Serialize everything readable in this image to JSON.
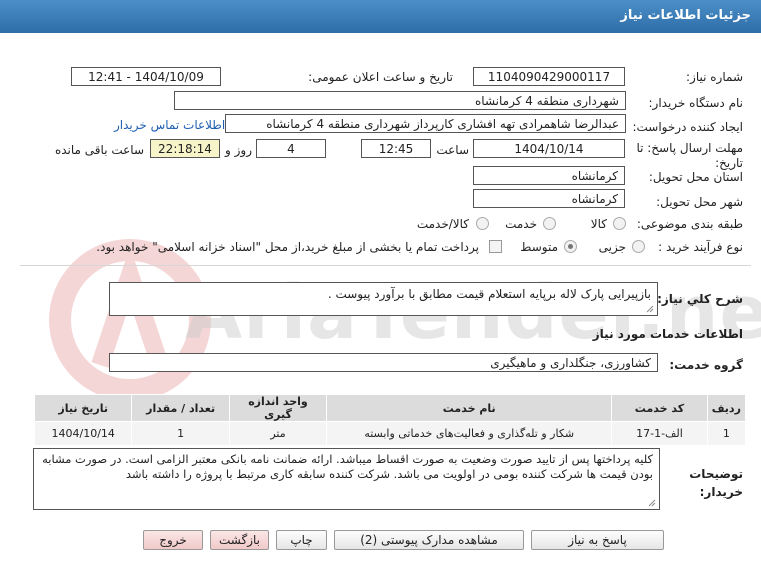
{
  "header": {
    "title": "جزئیات اطلاعات نیاز"
  },
  "fields": {
    "need_number_label": "شماره نیاز:",
    "need_number": "1104090429000117",
    "announce_label": "تاریخ و ساعت اعلان عمومی:",
    "announce_value": "1404/10/09 - 12:41",
    "buyer_org_label": "نام دستگاه خریدار:",
    "buyer_org": "شهرداری منطقه 4 کرمانشاه",
    "creator_label": "ایجاد کننده درخواست:",
    "creator": "عبدالرضا شاهمرادی تهه افشاری کارپرداز شهرداری منطقه 4 کرمانشاه",
    "contact_link": "اطلاعات تماس خریدار",
    "deadline_label": "مهلت ارسال پاسخ: تا تاریخ:",
    "deadline_date": "1404/10/14",
    "time_label": "ساعت",
    "deadline_time": "12:45",
    "days_value": "4",
    "days_label": "روز و",
    "remaining_time": "22:18:14",
    "remaining_label": "ساعت باقی مانده",
    "province_label": "استان محل تحویل:",
    "province": "کرمانشاه",
    "city_label": "شهر محل تحویل:",
    "city": "کرمانشاه",
    "category_label": "طبقه بندی موضوعی:",
    "category_options": [
      "کالا",
      "خدمت",
      "کالا/خدمت"
    ],
    "purchase_label": "نوع فرآیند خرید :",
    "purchase_options": [
      "جزیی",
      "متوسط"
    ],
    "treasury_text": "پرداخت تمام یا بخشی از مبلغ خرید،از محل \"اسناد خزانه اسلامی\" خواهد بود."
  },
  "description": {
    "label": "شرح کلي نياز:",
    "text": "بازپیرایی پارک لاله  برپایه استعلام قیمت مطابق با برآورد پیوست ."
  },
  "services": {
    "section_title": "اطلاعات خدمات مورد نياز",
    "group_label": "گروه خدمت:",
    "group_value": "کشاورزی، جنگلداری و ماهیگیری",
    "columns": [
      "ردیف",
      "کد خدمت",
      "نام خدمت",
      "واحد اندازه گیری",
      "تعداد / مقدار",
      "تاریخ نیاز"
    ],
    "rows": [
      [
        "1",
        "الف-1-17",
        "شکار و تله‌گذاری و فعالیت‌های خدماتی وابسته",
        "متر",
        "1",
        "1404/10/14"
      ]
    ]
  },
  "buyer_notes": {
    "label": "توضیحات خریدار:",
    "text": "کلیه پرداختها پس از تایید صورت وضعیت به صورت اقساط میباشد. ارائه ضمانت نامه بانکی معتبر الزامی است. در صورت مشابه بودن قیمت ها شرکت کننده بومی در اولویت می باشد. شرکت کننده سابقه کاری مرتبط با پروژه را داشته باشد"
  },
  "buttons": {
    "reply": "پاسخ به نیاز",
    "attachments": "مشاهده مدارک پیوستی (2)",
    "print": "چاپ",
    "back": "بازگشت",
    "exit": "خروج"
  },
  "watermark": {
    "text": "AriaTender.neT"
  }
}
